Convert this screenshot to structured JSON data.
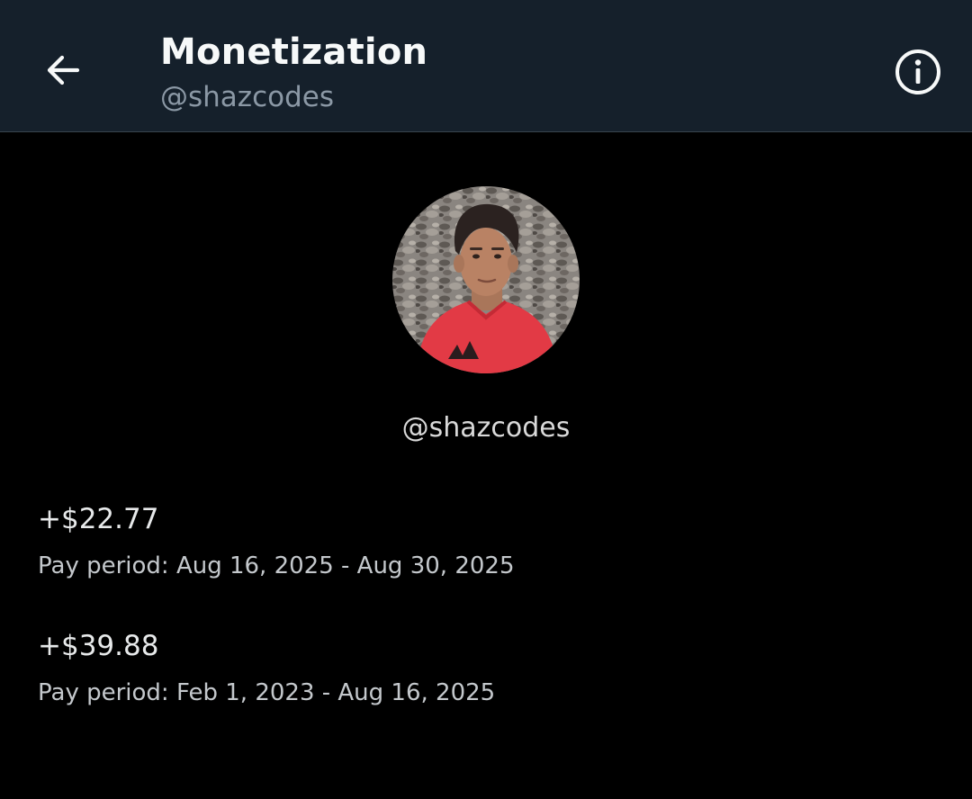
{
  "header": {
    "title": "Monetization",
    "subtitle": "@shazcodes",
    "back_icon": "arrow-left-icon",
    "info_icon": "info-circle-icon"
  },
  "profile": {
    "handle": "@shazcodes"
  },
  "payouts": [
    {
      "amount": "+$22.77",
      "period": "Pay period: Aug 16, 2025 - Aug 30, 2025"
    },
    {
      "amount": "+$39.88",
      "period": "Pay period: Feb 1, 2023 - Aug 16, 2025"
    }
  ],
  "colors": {
    "header_bg": "#15202b",
    "page_bg": "#000000",
    "title": "#f7f9f9",
    "subtitle": "#8b98a5"
  }
}
